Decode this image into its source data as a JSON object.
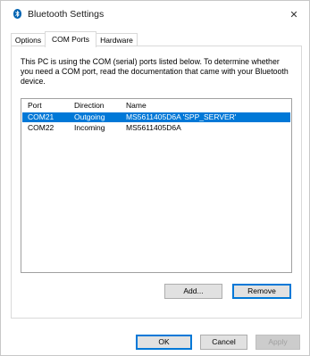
{
  "window": {
    "title": "Bluetooth Settings",
    "close_glyph": "✕"
  },
  "tabs": [
    {
      "label": "Options",
      "active": false
    },
    {
      "label": "COM Ports",
      "active": true
    },
    {
      "label": "Hardware",
      "active": false
    }
  ],
  "panel": {
    "description": "This PC is using the COM (serial) ports listed below. To determine whether you need a COM port, read the documentation that came with your Bluetooth device.",
    "list": {
      "columns": {
        "port": "Port",
        "direction": "Direction",
        "name": "Name"
      },
      "rows": [
        {
          "port": "COM21",
          "direction": "Outgoing",
          "name": "MS5611405D6A 'SPP_SERVER'",
          "selected": true
        },
        {
          "port": "COM22",
          "direction": "Incoming",
          "name": "MS5611405D6A",
          "selected": false
        }
      ]
    },
    "add_label": "Add...",
    "remove_label": "Remove"
  },
  "footer": {
    "ok_label": "OK",
    "cancel_label": "Cancel",
    "apply_label": "Apply"
  },
  "colors": {
    "selection": "#0078d7",
    "bluetooth_icon": "#0063b1"
  },
  "icons": {
    "title": "bluetooth-icon",
    "close": "close-icon"
  }
}
